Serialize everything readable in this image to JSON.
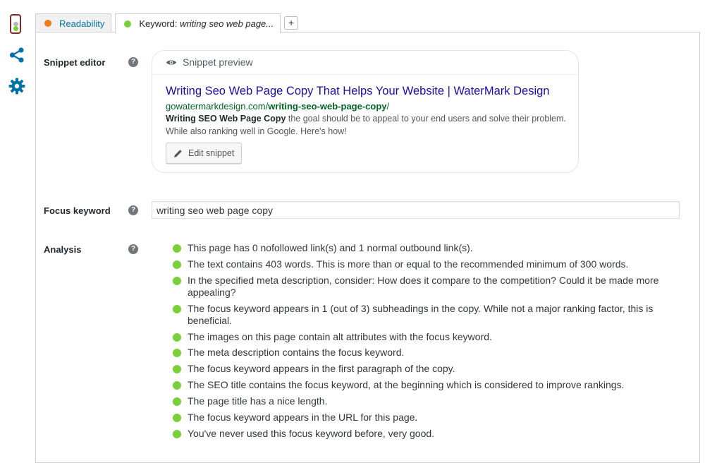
{
  "colors": {
    "green": "#7ad03a",
    "orange": "#ee7c1b",
    "red_light": "#dc3232",
    "link_blue": "#1a0dab",
    "url_green": "#006621",
    "accent": "#0073aa"
  },
  "side_icons": [
    "traffic-light-icon",
    "share-icon",
    "gear-icon"
  ],
  "tabs": {
    "readability_label": "Readability",
    "keyword_prefix": "Keyword:",
    "keyword_value": "writing seo web page...",
    "add_label": "+"
  },
  "snippet_editor": {
    "label": "Snippet editor",
    "help": "?",
    "preview_label": "Snippet preview",
    "title": "Writing Seo Web Page Copy That Helps Your Website | WaterMark Design",
    "url_base": "gowatermarkdesign.com/",
    "url_slug": "writing-seo-web-page-copy",
    "url_tail": "/",
    "desc_bold": "Writing SEO Web Page Copy",
    "desc_rest": " the goal should be to appeal to your end users and solve their problem. While also ranking well in Google. Here's how!",
    "edit_label": "Edit snippet"
  },
  "focus_keyword": {
    "label": "Focus keyword",
    "help": "?",
    "value": "writing seo web page copy"
  },
  "analysis": {
    "label": "Analysis",
    "help": "?",
    "items": [
      "This page has 0 nofollowed link(s) and 1 normal outbound link(s).",
      "The text contains 403 words. This is more than or equal to the recommended minimum of 300 words.",
      "In the specified meta description, consider: How does it compare to the competition? Could it be made more appealing?",
      "The focus keyword appears in 1 (out of 3) subheadings in the copy. While not a major ranking factor, this is beneficial.",
      "The images on this page contain alt attributes with the focus keyword.",
      "The meta description contains the focus keyword.",
      "The focus keyword appears in the first paragraph of the copy.",
      "The SEO title contains the focus keyword, at the beginning which is considered to improve rankings.",
      "The page title has a nice length.",
      "The focus keyword appears in the URL for this page.",
      "You've never used this focus keyword before, very good."
    ]
  }
}
